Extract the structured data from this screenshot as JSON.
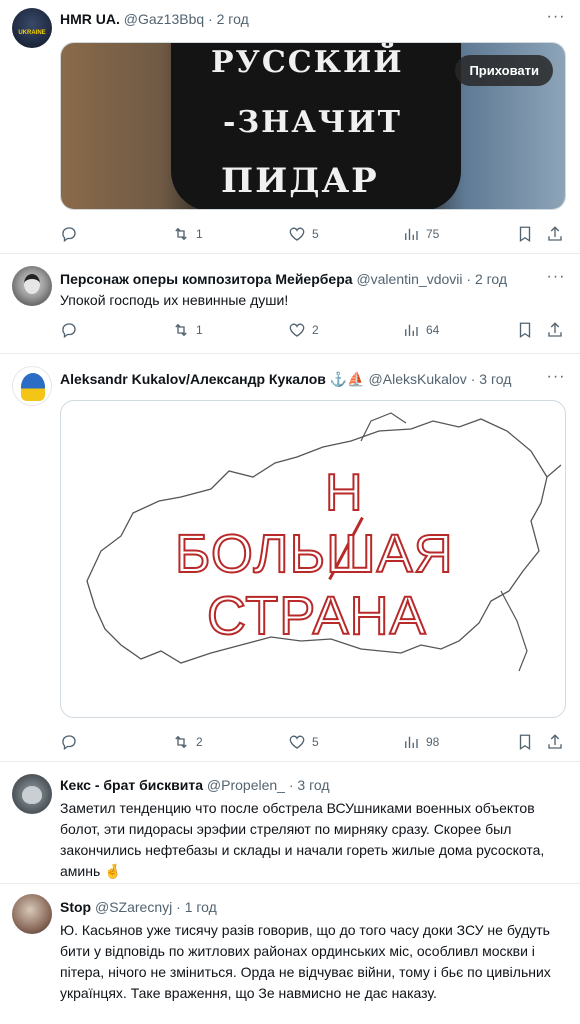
{
  "posts": [
    {
      "name": "HMR UA.",
      "handle": "@Gaz13Bbq",
      "time": "2 год",
      "avatar_text": "UKRAINE",
      "media_text": [
        "РУССКИЙ",
        "-ЗНАЧИТ",
        "ПИДАР"
      ],
      "hide_label": "Приховати",
      "replies": "",
      "reposts": "1",
      "likes": "5",
      "views": "75"
    },
    {
      "name": "Персонаж оперы композитора Мейербера",
      "handle": "@valentin_vdovii",
      "time": "2 год",
      "text": "Упокой господь их невинные души!",
      "replies": "",
      "reposts": "1",
      "likes": "2",
      "views": "64"
    },
    {
      "name": "Aleksandr Kukalov/Александр Кукалов",
      "emoji": "⚓⛵",
      "handle": "@AleksKukalov",
      "time": "3 год",
      "map_text": {
        "strike_letter": "Н",
        "line1_a": "БОЛЬ",
        "line1_b": "Ш",
        "line1_c": "АЯ",
        "line2": "СТРАНА"
      },
      "replies": "",
      "reposts": "2",
      "likes": "5",
      "views": "98"
    },
    {
      "name": "Кекс - брат бисквита",
      "handle": "@Propelen_",
      "time": "3 год",
      "text": "Заметил тенденцию что после обстрела ВСУшниками военных объектов болот, эти пидорасы эрэфии стреляют по мирняку сразу. Скорее был закончились нефтебазы и склады и начали гореть жилые дома русоскота, аминь 🤞"
    },
    {
      "name": "Stop",
      "handle": "@SZarecnyj",
      "time": "1 год",
      "text": "Ю. Касьянов уже тисячу разів говорив, що до того часу доки ЗСУ не будуть  бити у відповідь по  житлових районах ординських міс, особливл москви і пітера, нічого не зміниться. Орда не відчуває війни, тому і бьє по цивільних  українцях. Таке враження, що Зе навмисно не дає наказу."
    }
  ],
  "separator": " · ",
  "colors": {
    "text": "#0f1419",
    "secondary": "#536471",
    "border": "#e8ecef"
  }
}
